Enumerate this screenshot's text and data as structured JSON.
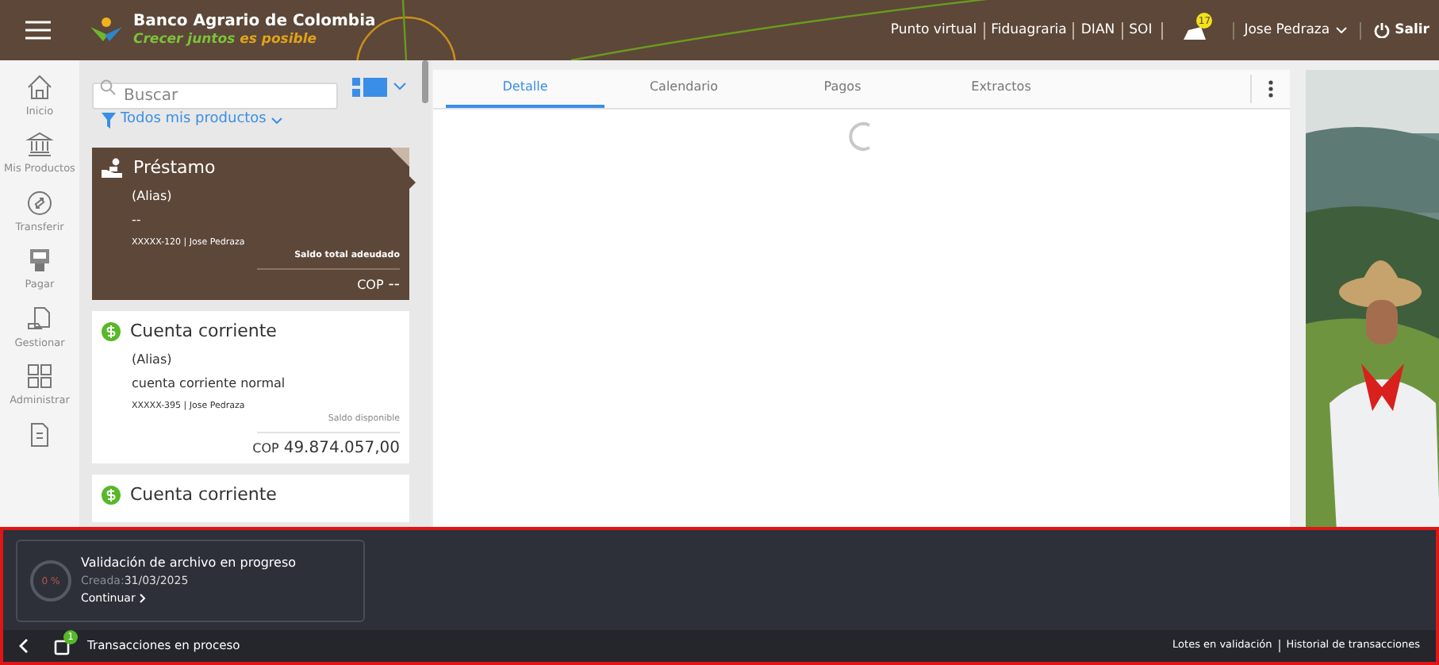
{
  "header": {
    "bank_name": "Banco Agrario de Colombia",
    "slogan_parts": [
      {
        "text": "Crecer juntos",
        "color": "#7cc13a"
      },
      {
        "text": "es posible",
        "color": "#e0a21c"
      }
    ],
    "links": [
      "Punto virtual",
      "Fiduagraria",
      "DIAN",
      "SOI"
    ],
    "notification_count": "17",
    "user": "Jose Pedraza",
    "logout": "Salir"
  },
  "nav": [
    {
      "label": "Inicio"
    },
    {
      "label": "Mis Productos"
    },
    {
      "label": "Transferir"
    },
    {
      "label": "Pagar"
    },
    {
      "label": "Gestionar"
    },
    {
      "label": "Administrar"
    }
  ],
  "search": {
    "placeholder": "Buscar"
  },
  "filter": "Todos mis productos",
  "products": [
    {
      "kind": "loan",
      "selected": true,
      "title": "Préstamo",
      "alias": "(Alias)",
      "subtitle": "--",
      "account": "XXXXX-120 | Jose Pedraza",
      "balance_label": "Saldo total adeudado",
      "currency": "COP",
      "amount": "--"
    },
    {
      "kind": "account",
      "selected": false,
      "title": "Cuenta corriente",
      "alias": "(Alias)",
      "subtitle": "cuenta corriente normal",
      "account": "XXXXX-395 | Jose Pedraza",
      "balance_label": "Saldo disponible",
      "currency": "COP",
      "amount": "49.874.057,00"
    },
    {
      "kind": "account",
      "selected": false,
      "title": "Cuenta corriente"
    }
  ],
  "tabs": [
    {
      "label": "Detalle",
      "selected": true
    },
    {
      "label": "Calendario",
      "selected": false
    },
    {
      "label": "Pagos",
      "selected": false
    },
    {
      "label": "Extractos",
      "selected": false
    }
  ],
  "process_card": {
    "percent": "0 %",
    "title": "Validación de archivo en progreso",
    "created_label": "Creada:",
    "created_date": "31/03/2025",
    "action": "Continuar"
  },
  "bottom_bar": {
    "count": "1",
    "title": "Transacciones en proceso",
    "links": [
      "Lotes en validación",
      "Historial de transacciones"
    ]
  }
}
